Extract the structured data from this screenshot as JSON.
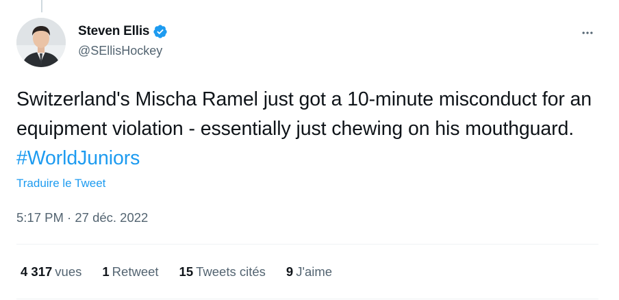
{
  "author": {
    "display_name": "Steven Ellis",
    "handle": "@SEllisHockey",
    "verified": true
  },
  "tweet": {
    "text": "Switzerland's Mischa Ramel just got a 10-minute misconduct for an equipment violation - essentially just chewing on his mouthguard. ",
    "hashtag": "#WorldJuniors",
    "translate_label": "Traduire le Tweet",
    "time": "5:17 PM",
    "separator": " · ",
    "date": "27 déc. 2022"
  },
  "stats": {
    "views": {
      "count": "4 317",
      "label": "vues"
    },
    "retweets": {
      "count": "1",
      "label": "Retweet"
    },
    "quotes": {
      "count": "15",
      "label": "Tweets cités"
    },
    "likes": {
      "count": "9",
      "label": "J'aime"
    }
  },
  "colors": {
    "accent": "#1d9bf0",
    "text": "#0f1419",
    "secondary": "#536471"
  },
  "icons": {
    "verified": "verified-badge-icon",
    "more": "more-horizontal-icon"
  }
}
